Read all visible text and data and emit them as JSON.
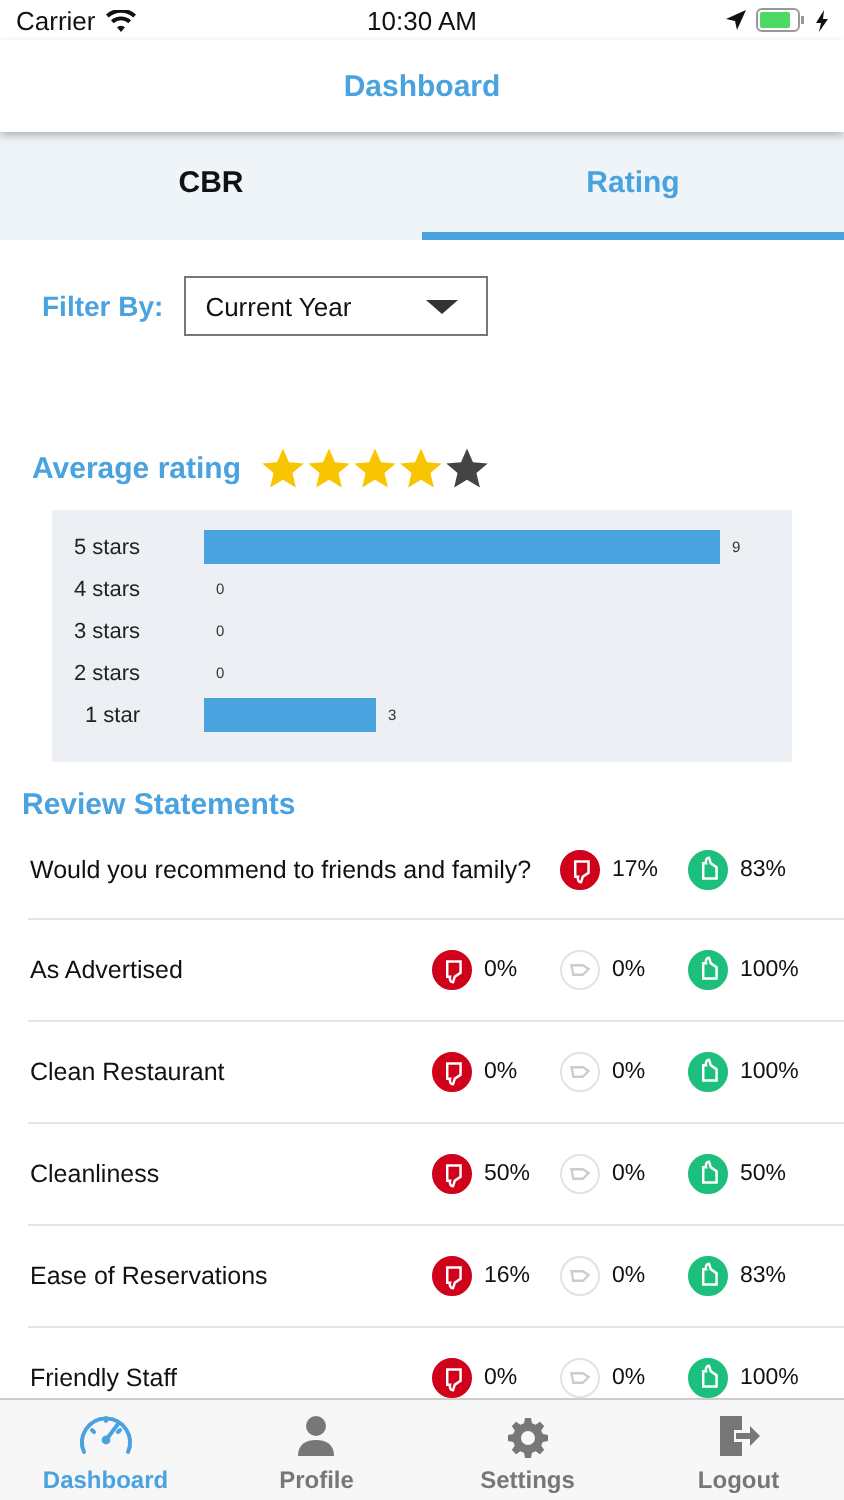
{
  "status_bar": {
    "carrier": "Carrier",
    "time": "10:30 AM"
  },
  "header": {
    "title": "Dashboard"
  },
  "tabs": [
    {
      "label": "CBR",
      "selected": false
    },
    {
      "label": "Rating",
      "selected": true
    }
  ],
  "filter": {
    "label": "Filter By:",
    "value": "Current Year"
  },
  "average_rating": {
    "label": "Average rating",
    "stars": 4
  },
  "rating_chart": {
    "chart_data": {
      "type": "bar",
      "orientation": "horizontal",
      "categories": [
        "5 stars",
        "4 stars",
        "3 stars",
        "2 stars",
        "1 star"
      ],
      "values": [
        9,
        0,
        0,
        0,
        3
      ],
      "data_labels": true
    }
  },
  "review_statements": {
    "title": "Review Statements",
    "rows": [
      {
        "statement": "Would you recommend to friends and family?",
        "negative": "17%",
        "positive": "83%"
      },
      {
        "statement": "As Advertised",
        "negative": "0%",
        "neutral": "0%",
        "positive": "100%"
      },
      {
        "statement": "Clean Restaurant",
        "negative": "0%",
        "neutral": "0%",
        "positive": "100%"
      },
      {
        "statement": "Cleanliness",
        "negative": "50%",
        "neutral": "0%",
        "positive": "50%"
      },
      {
        "statement": "Ease of Reservations",
        "negative": "16%",
        "neutral": "0%",
        "positive": "83%"
      },
      {
        "statement": "Friendly Staff",
        "negative": "0%",
        "neutral": "0%",
        "positive": "100%"
      }
    ]
  },
  "bottom_nav": [
    {
      "label": "Dashboard",
      "selected": true
    },
    {
      "label": "Profile",
      "selected": false
    },
    {
      "label": "Settings",
      "selected": false
    },
    {
      "label": "Logout",
      "selected": false
    }
  ]
}
